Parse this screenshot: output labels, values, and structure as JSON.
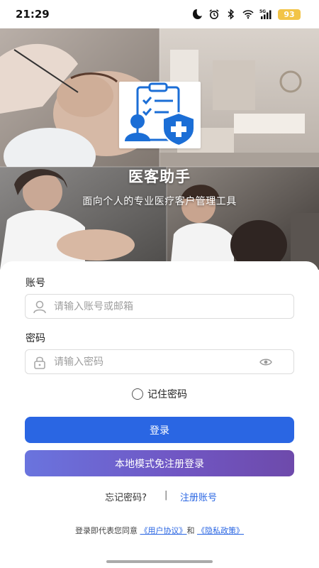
{
  "status_bar": {
    "time": "21:29",
    "battery": "93",
    "network": "5G"
  },
  "app": {
    "title": "医客助手",
    "subtitle": "面向个人的专业医疗客户管理工具"
  },
  "form": {
    "account_label": "账号",
    "account_placeholder": "请输入账号或邮箱",
    "password_label": "密码",
    "password_placeholder": "请输入密码",
    "remember_label": "记住密码",
    "remember_checked": false
  },
  "buttons": {
    "login": "登录",
    "local_mode": "本地模式免注册登录"
  },
  "links": {
    "forgot": "忘记密码?",
    "separator": "|",
    "register": "注册账号"
  },
  "agreement": {
    "prefix": "登录即代表您同意",
    "user_agreement": "《用户协议》",
    "and": "和",
    "privacy_policy": "《隐私政策》"
  },
  "colors": {
    "primary": "#2a66e3",
    "local_start": "#6a74de",
    "local_end": "#6e4aab",
    "battery": "#f2c447"
  },
  "icons": [
    "moon-icon",
    "alarm-icon",
    "bluetooth-icon",
    "wifi-icon",
    "signal-icon",
    "user-icon",
    "lock-icon",
    "eye-icon",
    "clipboard-shield-logo"
  ]
}
